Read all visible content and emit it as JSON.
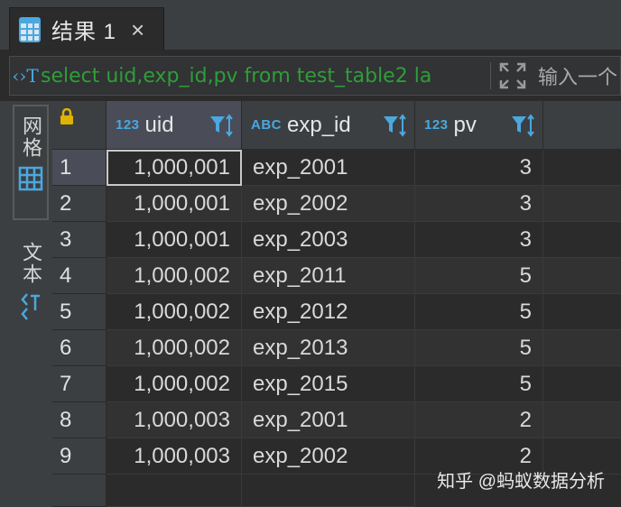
{
  "tab": {
    "title": "结果 1",
    "close": "×",
    "icon": "table-grid-icon"
  },
  "filter": {
    "query": "select uid,exp_id,pv from test_table2 la",
    "placeholder": "输入一个",
    "icon_glyph": "‹›T"
  },
  "side": {
    "grid_label": "网格",
    "text_label": "文本"
  },
  "columns": [
    {
      "type": "123",
      "name": "uid"
    },
    {
      "type": "ABC",
      "name": "exp_id"
    },
    {
      "type": "123",
      "name": "pv"
    }
  ],
  "rows": [
    {
      "n": "1",
      "uid": "1,000,001",
      "exp_id": "exp_2001",
      "pv": "3"
    },
    {
      "n": "2",
      "uid": "1,000,001",
      "exp_id": "exp_2002",
      "pv": "3"
    },
    {
      "n": "3",
      "uid": "1,000,001",
      "exp_id": "exp_2003",
      "pv": "3"
    },
    {
      "n": "4",
      "uid": "1,000,002",
      "exp_id": "exp_2011",
      "pv": "5"
    },
    {
      "n": "5",
      "uid": "1,000,002",
      "exp_id": "exp_2012",
      "pv": "5"
    },
    {
      "n": "6",
      "uid": "1,000,002",
      "exp_id": "exp_2013",
      "pv": "5"
    },
    {
      "n": "7",
      "uid": "1,000,002",
      "exp_id": "exp_2015",
      "pv": "5"
    },
    {
      "n": "8",
      "uid": "1,000,003",
      "exp_id": "exp_2001",
      "pv": "2"
    },
    {
      "n": "9",
      "uid": "1,000,003",
      "exp_id": "exp_2002",
      "pv": "2"
    }
  ],
  "watermark": "知乎 @蚂蚁数据分析",
  "colors": {
    "accent": "#4aa8e0",
    "query": "#2f9e37",
    "lock": "#e0b300"
  }
}
